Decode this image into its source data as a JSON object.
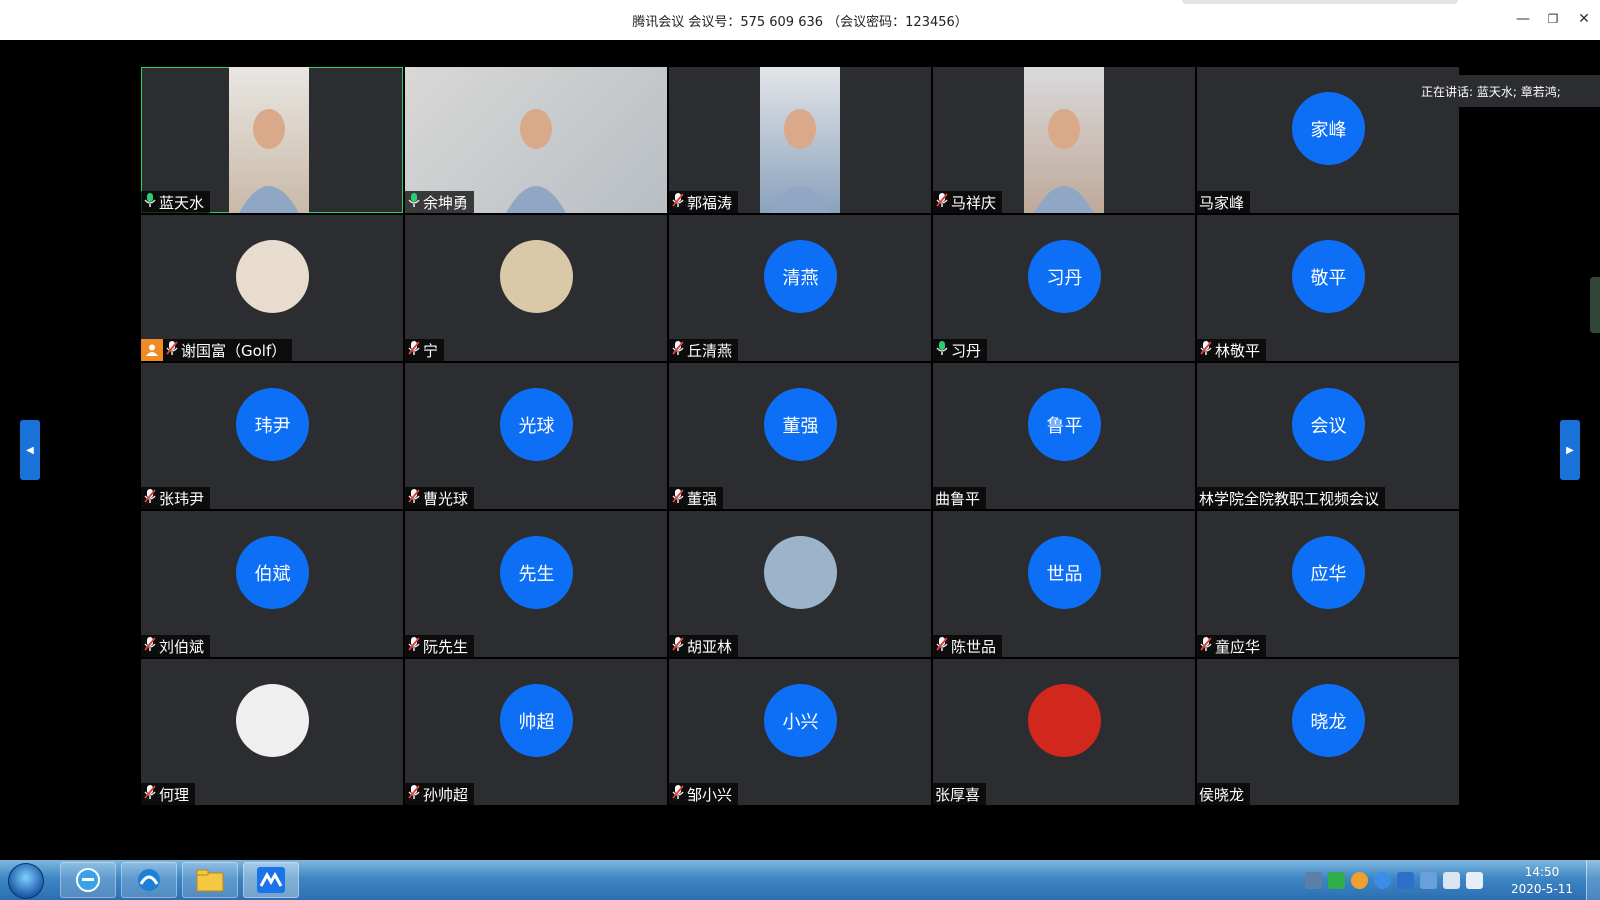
{
  "window": {
    "title": "腾讯会议 会议号：575 609 636 （会议密码：123456）",
    "minimize": "—",
    "restore": "❐",
    "close": "✕"
  },
  "speaking": "正在讲话: 蓝天水; 章若鸿;",
  "colors": {
    "avatar": "#0c6ff5",
    "active_border": "#2ecc71",
    "host_badge": "#f08a24",
    "tile_bg": "#2b2d30"
  },
  "participants": [
    {
      "name": "蓝天水",
      "mic": "on",
      "media": "video"
    },
    {
      "name": "余坤勇",
      "mic": "on",
      "media": "video"
    },
    {
      "name": "郭福涛",
      "mic": "muted",
      "media": "video"
    },
    {
      "name": "马祥庆",
      "mic": "muted",
      "media": "video"
    },
    {
      "name": "马家峰",
      "mic": "none",
      "media": "avatar",
      "avatar_text": "家峰"
    },
    {
      "name": "谢国富（Golf）",
      "mic": "muted",
      "media": "photo",
      "host": true
    },
    {
      "name": "宁",
      "mic": "muted",
      "media": "photo"
    },
    {
      "name": "丘清燕",
      "mic": "muted",
      "media": "avatar",
      "avatar_text": "清燕"
    },
    {
      "name": "习丹",
      "mic": "on",
      "media": "avatar",
      "avatar_text": "习丹"
    },
    {
      "name": "林敬平",
      "mic": "muted",
      "media": "avatar",
      "avatar_text": "敬平"
    },
    {
      "name": "张玮尹",
      "mic": "muted",
      "media": "avatar",
      "avatar_text": "玮尹"
    },
    {
      "name": "曹光球",
      "mic": "muted",
      "media": "avatar",
      "avatar_text": "光球"
    },
    {
      "name": "董强",
      "mic": "muted",
      "media": "avatar",
      "avatar_text": "董强"
    },
    {
      "name": "曲鲁平",
      "mic": "none",
      "media": "avatar",
      "avatar_text": "鲁平"
    },
    {
      "name": "林学院全院教职工视频会议",
      "mic": "none",
      "media": "avatar",
      "avatar_text": "会议"
    },
    {
      "name": "刘伯斌",
      "mic": "muted",
      "media": "avatar",
      "avatar_text": "伯斌"
    },
    {
      "name": "阮先生",
      "mic": "muted",
      "media": "avatar",
      "avatar_text": "先生"
    },
    {
      "name": "胡亚林",
      "mic": "muted",
      "media": "photo"
    },
    {
      "name": "陈世品",
      "mic": "muted",
      "media": "avatar",
      "avatar_text": "世品"
    },
    {
      "name": "童应华",
      "mic": "muted",
      "media": "avatar",
      "avatar_text": "应华"
    },
    {
      "name": "何理",
      "mic": "muted",
      "media": "photo"
    },
    {
      "name": "孙帅超",
      "mic": "muted",
      "media": "avatar",
      "avatar_text": "帅超"
    },
    {
      "name": "邹小兴",
      "mic": "muted",
      "media": "avatar",
      "avatar_text": "小兴"
    },
    {
      "name": "张厚喜",
      "mic": "none",
      "media": "photo"
    },
    {
      "name": "侯晓龙",
      "mic": "none",
      "media": "avatar",
      "avatar_text": "晓龙"
    }
  ],
  "taskbar": {
    "items": [
      "start-orb-icon",
      "internet-explorer-icon",
      "browser-icon",
      "file-explorer-icon",
      "tencent-meeting-icon"
    ],
    "time": "14:50",
    "date": "2020-5-11"
  }
}
